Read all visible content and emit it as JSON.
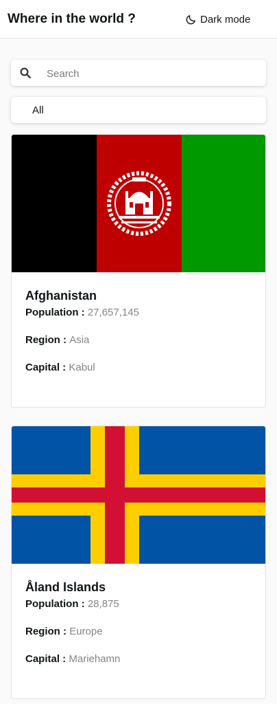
{
  "header": {
    "title": "Where in the world ?",
    "dark_mode_label": "Dark mode"
  },
  "search": {
    "placeholder": "Search",
    "value": ""
  },
  "filter": {
    "selected": "All"
  },
  "labels": {
    "population": "Population",
    "region": "Region",
    "capital": "Capital",
    "separator": " : "
  },
  "countries": [
    {
      "name": "Afghanistan",
      "population": "27,657,145",
      "region": "Asia",
      "capital": "Kabul",
      "flag_colors": [
        "#000000",
        "#be0000",
        "#009900"
      ]
    },
    {
      "name": "Åland Islands",
      "population": "28,875",
      "region": "Europe",
      "capital": "Mariehamn",
      "flag_colors": [
        "#0053a5",
        "#ffce00",
        "#d21034"
      ]
    }
  ]
}
